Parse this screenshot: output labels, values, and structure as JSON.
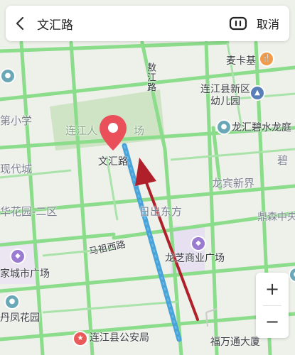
{
  "search": {
    "query": "文汇路",
    "cancel_label": "取消"
  },
  "zoom": {
    "in_label": "+",
    "out_label": "−"
  },
  "map": {
    "selected_road": "文汇路",
    "pin_color": "#e9505a",
    "route_color": "#4aa3d8",
    "arrow_color": "#b0202a",
    "road_color": "#8bdc8b",
    "labels": {
      "road_aojiang": "敖江路",
      "road_mazu_west": "马祖西路",
      "road_wenhui": "文汇路",
      "maikaji": "麦卡基",
      "kindergarten_line1": "连江县新区",
      "kindergarten_line2": "幼儿园",
      "longhui": "龙汇碧水龙庭",
      "bi": "碧",
      "primary_school": "第小学",
      "lianjiang_park": "连江人",
      "park_suffix": "场",
      "modern_city": "现代城",
      "hua_garden": "华花园-二区",
      "longbin": "龙宾新界",
      "richu": "日出东方",
      "dingsen": "鼎森中央",
      "longzhi": "龙芝商业广场",
      "home_city": "家城市广场",
      "danfeng": "丹凤花园",
      "police": "连江县公安局",
      "fuwantong": "福万通大厦"
    }
  }
}
